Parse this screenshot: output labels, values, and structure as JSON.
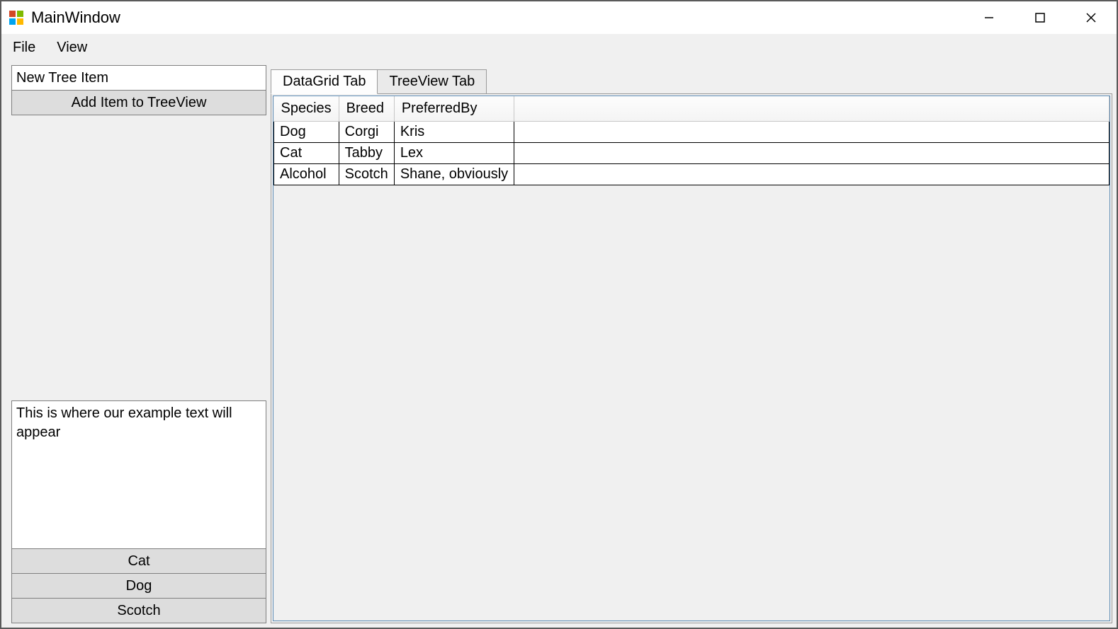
{
  "window": {
    "title": "MainWindow"
  },
  "menu": {
    "file": "File",
    "view": "View"
  },
  "left": {
    "tree_input_value": "New Tree Item",
    "add_button": "Add Item to TreeView",
    "example_text": "This is where our example text will appear",
    "buttons": [
      "Cat",
      "Dog",
      "Scotch"
    ]
  },
  "tabs": {
    "datagrid": "DataGrid Tab",
    "treeview": "TreeView Tab",
    "active": "datagrid"
  },
  "grid": {
    "columns": [
      "Species",
      "Breed",
      "PreferredBy"
    ],
    "rows": [
      {
        "species": "Dog",
        "breed": "Corgi",
        "preferred": "Kris"
      },
      {
        "species": "Cat",
        "breed": "Tabby",
        "preferred": "Lex"
      },
      {
        "species": "Alcohol",
        "breed": "Scotch",
        "preferred": "Shane, obviously"
      }
    ]
  }
}
